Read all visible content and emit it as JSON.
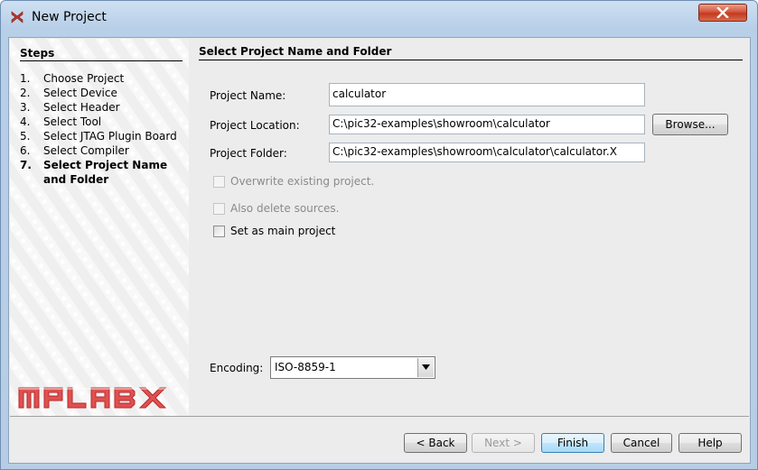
{
  "window": {
    "title": "New Project"
  },
  "steps": {
    "heading": "Steps",
    "items": [
      {
        "num": "1.",
        "label": "Choose Project",
        "current": false
      },
      {
        "num": "2.",
        "label": "Select Device",
        "current": false
      },
      {
        "num": "3.",
        "label": "Select Header",
        "current": false
      },
      {
        "num": "4.",
        "label": "Select Tool",
        "current": false
      },
      {
        "num": "5.",
        "label": "Select JTAG Plugin Board",
        "current": false
      },
      {
        "num": "6.",
        "label": "Select Compiler",
        "current": false
      },
      {
        "num": "7.",
        "label": "Select Project Name",
        "current": true
      },
      {
        "num": "",
        "label": "and Folder",
        "current": true
      }
    ],
    "logo_text": "MPLABX"
  },
  "main": {
    "title": "Select Project Name and Folder",
    "project_name": {
      "label": "Project Name:",
      "value": "calculator"
    },
    "project_location": {
      "label": "Project Location:",
      "value": "C:\\pic32-examples\\showroom\\calculator"
    },
    "project_folder": {
      "label": "Project Folder:",
      "value": "C:\\pic32-examples\\showroom\\calculator\\calculator.X"
    },
    "browse_label": "Browse...",
    "overwrite": {
      "label": "Overwrite existing project.",
      "checked": false,
      "enabled": false
    },
    "delete_sources": {
      "label": "Also delete sources.",
      "checked": false,
      "enabled": false
    },
    "main_project": {
      "label": "Set as main project",
      "checked": false,
      "enabled": true
    },
    "encoding": {
      "label": "Encoding:",
      "value": "ISO-8859-1"
    }
  },
  "footer": {
    "back": "< Back",
    "next": "Next >",
    "finish": "Finish",
    "cancel": "Cancel",
    "help": "Help"
  },
  "colors": {
    "logo_red": "#d33a3a",
    "close_red": "#c23a20"
  }
}
